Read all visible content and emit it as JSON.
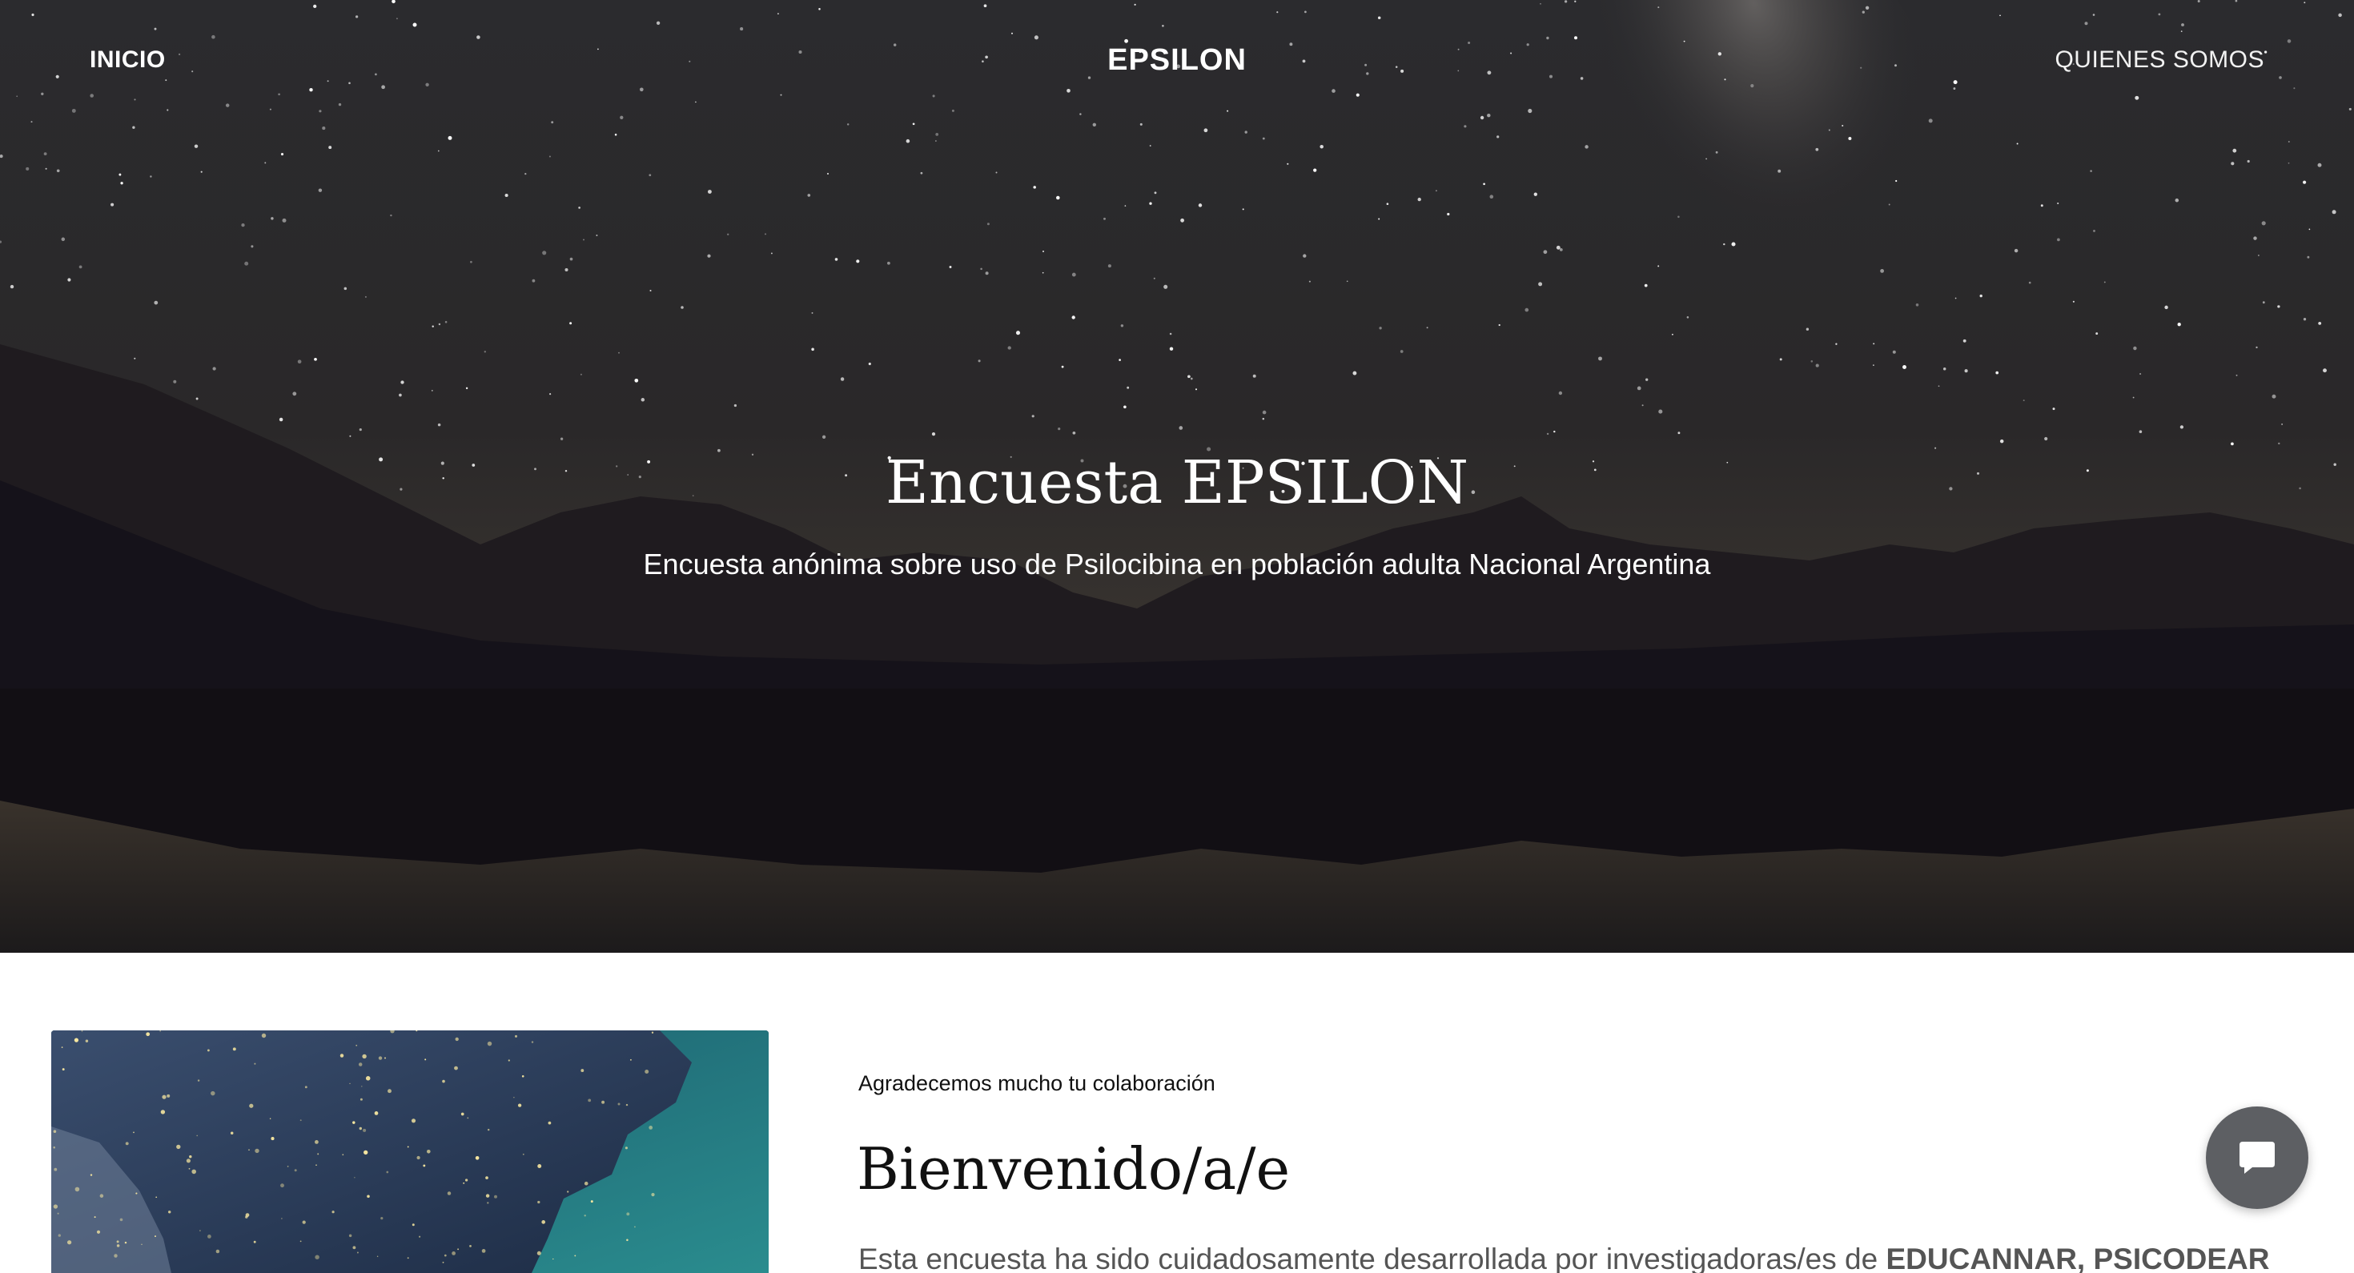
{
  "nav": {
    "home_label": "INICIO",
    "brand": "EPSILON",
    "about_label": "QUIENES SOMOS"
  },
  "hero": {
    "title": "Encuesta EPSILON",
    "subtitle": "Encuesta anónima sobre uso de Psilocibina en población adulta Nacional Argentina",
    "background_image": "night-sky-mountains-lake-photo"
  },
  "intro": {
    "eyebrow": "Agradecemos mucho tu colaboración",
    "heading": "Bienvenido/a/e",
    "text_prefix": "Esta encuesta ha sido cuidadosamente desarrollada por investigadoras/es de ",
    "text_bold": "EDUCANNAR, PSICODEAR",
    "image": "argentina-satellite-night-photo"
  },
  "chat": {
    "icon": "chat-bubble-icon"
  },
  "colors": {
    "hero_text": "#ffffff",
    "body_text": "#111111",
    "muted_text": "#555555",
    "chat_button": "#5d5f63"
  }
}
